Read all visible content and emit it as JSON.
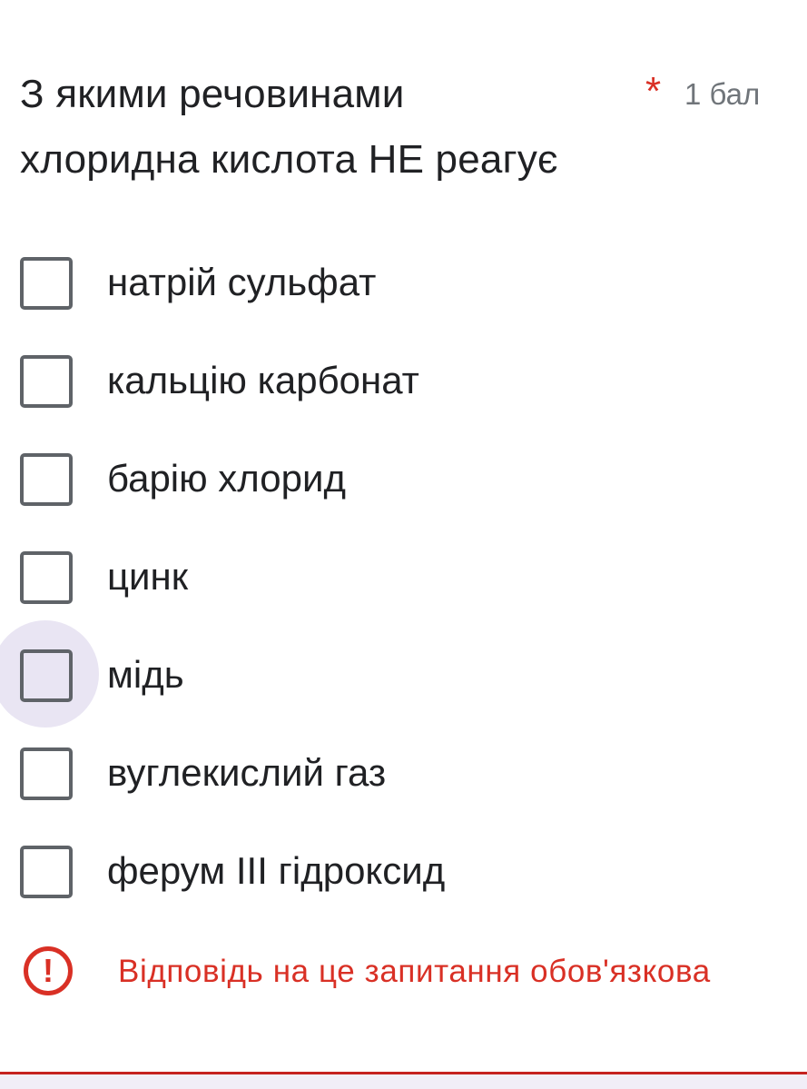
{
  "question": {
    "title_line1": "З якими речовинами",
    "title_line2": "хлоридна кислота НЕ реагує",
    "required_mark": "*",
    "points": "1 бал"
  },
  "options": [
    {
      "label": "натрій сульфат",
      "checked": false
    },
    {
      "label": "кальцію карбонат",
      "checked": false
    },
    {
      "label": "барію хлорид",
      "checked": false
    },
    {
      "label": "цинк",
      "checked": false
    },
    {
      "label": "мідь",
      "checked": false,
      "focused": true
    },
    {
      "label": "вуглекислий газ",
      "checked": false
    },
    {
      "label": "ферум ІІІ гідроксид",
      "checked": false
    }
  ],
  "error": {
    "icon": "exclamation-circle-icon",
    "icon_glyph": "!",
    "text": "Відповідь на це запитання обов'язкова"
  },
  "colors": {
    "error": "#d93025",
    "text": "#202124",
    "checkbox_border": "#5f6368",
    "focus_ripple": "#e9e5f3"
  }
}
